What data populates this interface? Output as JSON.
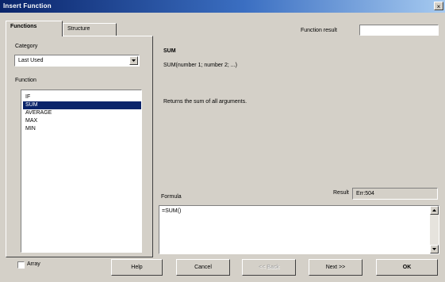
{
  "window": {
    "title": "Insert Function",
    "close_glyph": "×"
  },
  "tabs": [
    {
      "label": "Functions",
      "active": true
    },
    {
      "label": "Structure",
      "active": false
    }
  ],
  "left": {
    "category_label": "Category",
    "category_value": "Last Used",
    "function_label": "Function",
    "functions": [
      {
        "label": "IF",
        "selected": false
      },
      {
        "label": "SUM",
        "selected": true
      },
      {
        "label": "AVERAGE",
        "selected": false
      },
      {
        "label": "MAX",
        "selected": false
      },
      {
        "label": "MIN",
        "selected": false
      }
    ]
  },
  "right": {
    "function_result_label": "Function result",
    "function_result_value": "",
    "function_name": "SUM",
    "syntax": "SUM(number 1; number 2; ...)",
    "description": "Returns the sum of all arguments.",
    "formula_label": "Formula",
    "result_label": "Result",
    "result_value": "Err:504",
    "formula_value": "=SUM()"
  },
  "bottom": {
    "array_label": "Array",
    "array_checked": false,
    "buttons": {
      "help": "Help",
      "cancel": "Cancel",
      "back": "<< Back",
      "next": "Next >>",
      "ok": "OK"
    },
    "back_disabled": true
  },
  "icons": {
    "dropdown": "chevron-down-icon",
    "scroll_up": "arrow-up-icon",
    "scroll_down": "arrow-down-icon"
  },
  "colors": {
    "titlebar_start": "#0a246a",
    "titlebar_end": "#a6caf0",
    "selection": "#0a246a",
    "face": "#d4d0c8"
  }
}
